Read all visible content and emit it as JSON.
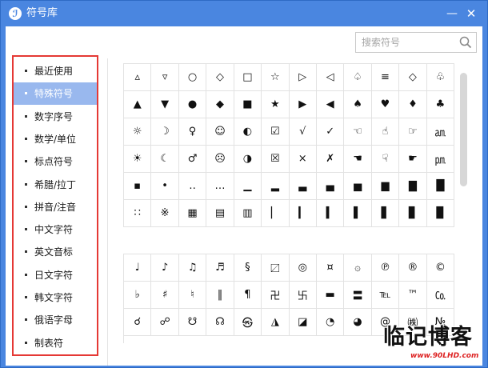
{
  "window": {
    "title": "符号库",
    "app_icon_glyph": "ℐ",
    "minimize_glyph": "—",
    "close_glyph": "✕"
  },
  "search": {
    "placeholder": "搜索符号",
    "icon": "search-icon"
  },
  "sidebar": {
    "active_index": 1,
    "highlight_color": "#e53935",
    "active_bg": "#99b8ee",
    "items": [
      {
        "label": "最近使用"
      },
      {
        "label": "特殊符号"
      },
      {
        "label": "数字序号"
      },
      {
        "label": "数学/单位"
      },
      {
        "label": "标点符号"
      },
      {
        "label": "希腊/拉丁"
      },
      {
        "label": "拼音/注音"
      },
      {
        "label": "中文字符"
      },
      {
        "label": "英文音标"
      },
      {
        "label": "日文字符"
      },
      {
        "label": "韩文字符"
      },
      {
        "label": "俄语字母"
      },
      {
        "label": "制表符"
      }
    ]
  },
  "symbol_grid_1": [
    [
      "▵",
      "▿",
      "○",
      "◇",
      "□",
      "☆",
      "▷",
      "◁",
      "♤",
      "≡",
      "◇",
      "♧"
    ],
    [
      "▲",
      "▼",
      "●",
      "◆",
      "■",
      "★",
      "▶",
      "◀",
      "♠",
      "♥",
      "♦",
      "♣"
    ],
    [
      "☼",
      "☽",
      "♀",
      "☺",
      "◐",
      "☑",
      "√",
      "✓",
      "☜",
      "☝",
      "☞",
      "㏂"
    ],
    [
      "☀",
      "☾",
      "♂",
      "☹",
      "◑",
      "☒",
      "×",
      "✗",
      "☚",
      "☟",
      "☛",
      "㏘"
    ],
    [
      "▪",
      "•",
      "‥",
      "…",
      "▁",
      "▂",
      "▃",
      "▄",
      "▅",
      "▆",
      "▇",
      "█"
    ],
    [
      "∷",
      "※",
      "▦",
      "▤",
      "▥",
      "▏",
      "▎",
      "▍",
      "▌",
      "▋",
      "▊",
      "▉"
    ]
  ],
  "symbol_grid_2": [
    [
      "♩",
      "♪",
      "♫",
      "♬",
      "§",
      "〼",
      "◎",
      "¤",
      "۞",
      "℗",
      "®",
      "©"
    ],
    [
      "♭",
      "♯",
      "♮",
      "‖",
      "¶",
      "卍",
      "卐",
      "▬",
      "〓",
      "℡",
      "™",
      "㏇"
    ],
    [
      "☌",
      "☍",
      "☋",
      "☊",
      "㉿",
      "◮",
      "◪",
      "◔",
      "◕",
      "@",
      "㈱",
      "№"
    ]
  ],
  "watermark": {
    "text": "临记博客",
    "url": "www.90LHD.com"
  },
  "colors": {
    "titlebar": "#4a86e0",
    "red_box": "#e53935"
  }
}
